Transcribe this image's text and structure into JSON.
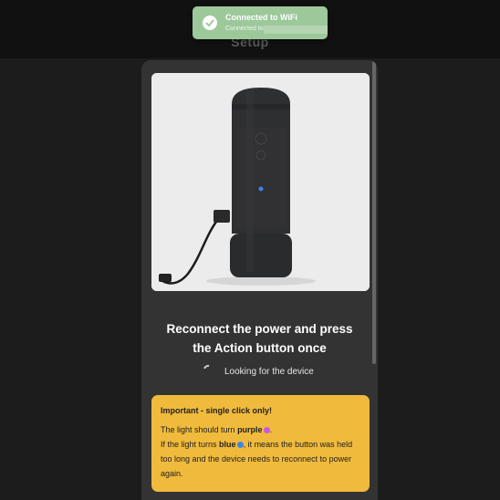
{
  "toast": {
    "title": "Connected to WiFi",
    "subtitle": "Connected to",
    "icon": "check-circle-icon",
    "color": "#9cc89a"
  },
  "header": {
    "title": "Setup"
  },
  "card": {
    "heading_line1": "Reconnect the power and press",
    "heading_line2": "the Action button once",
    "status": "Looking for the device"
  },
  "notice": {
    "title": "Important - single click only!",
    "line1_prefix": "The light should turn ",
    "purple_word": "purple",
    "line2_prefix": "If the light turns ",
    "blue_word": "blue",
    "line2_suffix": ", it means the button was held too long and the device needs to reconnect to power again.",
    "purple_color": "#cc55e6",
    "blue_color": "#3a86e8",
    "background": "#f0ba3c"
  },
  "colors": {
    "background": "#1c1c1c",
    "card": "#333333",
    "topbar": "#111111"
  }
}
